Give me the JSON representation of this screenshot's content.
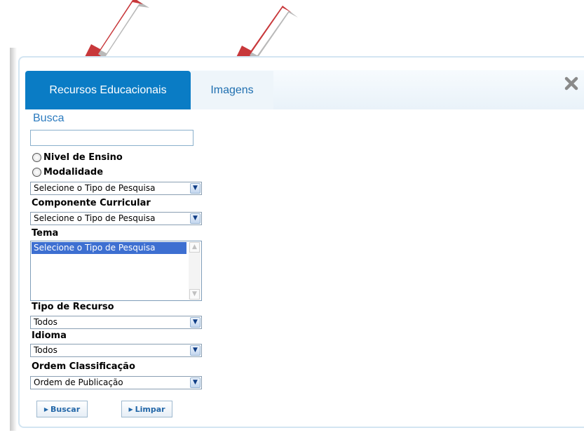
{
  "tabs": [
    {
      "label": "Recursos Educacionais",
      "active": true
    },
    {
      "label": "Imagens",
      "active": false
    }
  ],
  "icons": {
    "close": "close-x-icon",
    "annotation_arrows": "red-arrow-icon",
    "select_arrow": "chevron-down-icon"
  },
  "colors": {
    "active_tab": "#0a7cc5",
    "tab_text": "#1f6fb0",
    "arrow": "#c8383b",
    "highlight": "#3d6fd1"
  },
  "search": {
    "label": "Busca",
    "value": ""
  },
  "radios": [
    {
      "label": "Nivel de Ensino",
      "checked": false
    },
    {
      "label": "Modalidade",
      "checked": false
    }
  ],
  "select1": {
    "value": "Selecione o Tipo de Pesquisa"
  },
  "componente": {
    "label": "Componente Curricular",
    "value": "Selecione o Tipo de Pesquisa"
  },
  "tema": {
    "label": "Tema",
    "selected": "Selecione o Tipo de Pesquisa"
  },
  "tipo_recurso": {
    "label": "Tipo de Recurso",
    "value": "Todos"
  },
  "idioma": {
    "label": "Idioma",
    "value": "Todos"
  },
  "ordem": {
    "label": "Ordem Classificação",
    "value": "Ordem de Publicação"
  },
  "buttons": {
    "buscar": "Buscar",
    "limpar": "Limpar"
  }
}
